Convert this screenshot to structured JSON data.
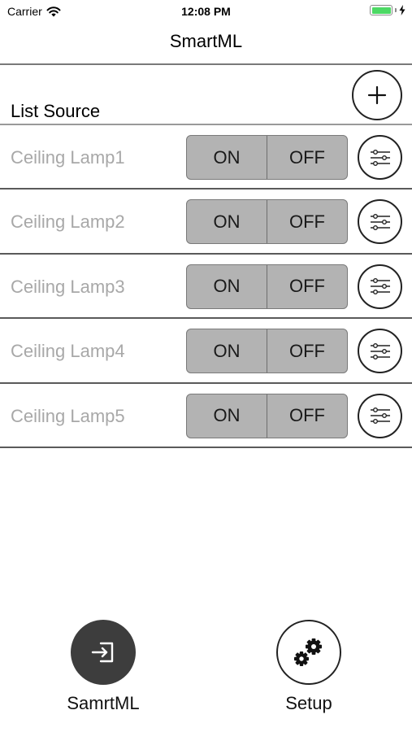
{
  "status_bar": {
    "carrier": "Carrier",
    "time": "12:08 PM",
    "battery_level": 1.0,
    "wifi_icon": "wifi-icon",
    "battery_icon": "battery-icon",
    "charging_icon": "bolt-icon"
  },
  "nav": {
    "title": "SmartML"
  },
  "list": {
    "header_label": "List Source",
    "add_icon": "plus-icon",
    "items": [
      {
        "label": "Ceiling Lamp1",
        "on_label": "ON",
        "off_label": "OFF",
        "settings_icon": "sliders-icon"
      },
      {
        "label": "Ceiling Lamp2",
        "on_label": "ON",
        "off_label": "OFF",
        "settings_icon": "sliders-icon"
      },
      {
        "label": "Ceiling Lamp3",
        "on_label": "ON",
        "off_label": "OFF",
        "settings_icon": "sliders-icon"
      },
      {
        "label": "Ceiling Lamp4",
        "on_label": "ON",
        "off_label": "OFF",
        "settings_icon": "sliders-icon"
      },
      {
        "label": "Ceiling Lamp5",
        "on_label": "ON",
        "off_label": "OFF",
        "settings_icon": "sliders-icon"
      }
    ]
  },
  "tabbar": {
    "tabs": [
      {
        "label": "SamrtML",
        "icon": "sign-in-icon",
        "active": true
      },
      {
        "label": "Setup",
        "icon": "gears-icon",
        "active": false
      }
    ]
  },
  "colors": {
    "segment_bg": "#b3b3b3",
    "row_label": "#a8a8a8",
    "active_tab": "#3d3d3d",
    "battery": "#4cd964"
  }
}
